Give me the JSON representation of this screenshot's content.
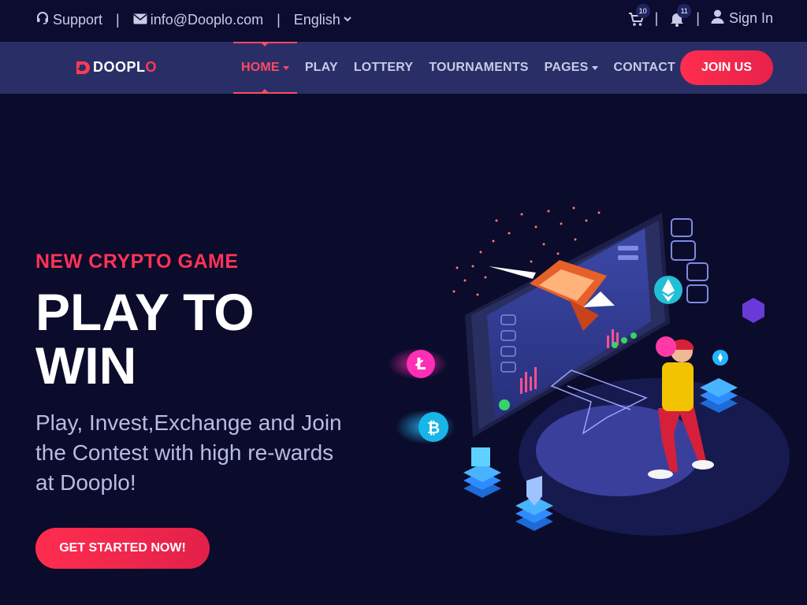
{
  "topbar": {
    "support_label": "Support",
    "email_label": "info@Dooplo.com",
    "language_label": "English",
    "cart_count": "10",
    "notifications_count": "11",
    "signin_label": "Sign In",
    "separator": "|"
  },
  "navbar": {
    "logo_text_main": "DOOPL",
    "logo_text_accent": "O",
    "items": [
      {
        "label": "HOME",
        "active": true,
        "dropdown": true
      },
      {
        "label": "PLAY"
      },
      {
        "label": "LOTTERY"
      },
      {
        "label": "TOURNAMENTS"
      },
      {
        "label": "PAGES",
        "dropdown": true
      },
      {
        "label": "CONTACT"
      }
    ],
    "join_label": "JOIN US"
  },
  "hero": {
    "eyebrow": "NEW CRYPTO GAME",
    "headline_line1": "PLAY TO",
    "headline_line2": "WIN",
    "subtext": "Play, Invest,Exchange and Join the Contest with high re-wards at Dooplo!",
    "cta_label": "GET STARTED NOW!"
  },
  "colors": {
    "background": "#0b0b2b",
    "topbar": "#0c0c30",
    "navbar": "#292f66",
    "accent": "#ff3355",
    "text_muted": "#b8bce4"
  }
}
